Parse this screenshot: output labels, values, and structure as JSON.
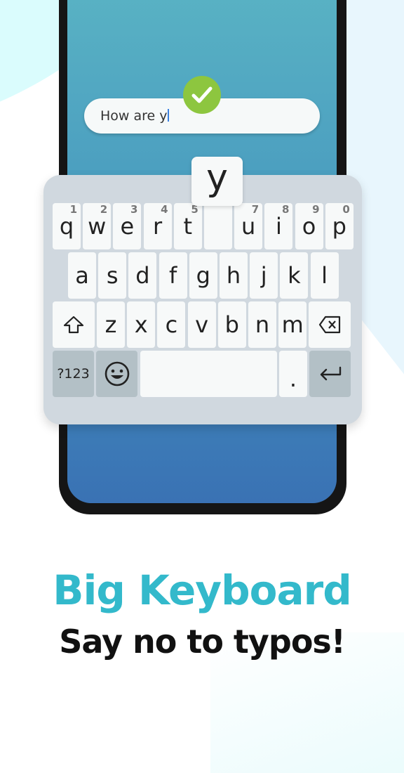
{
  "input": {
    "text": "How are y"
  },
  "status": {
    "icon": "checkmark-icon",
    "color": "#8dc63f"
  },
  "popup": {
    "letter": "y"
  },
  "keyboard": {
    "row1": [
      {
        "k": "q",
        "h": "1"
      },
      {
        "k": "w",
        "h": "2"
      },
      {
        "k": "e",
        "h": "3"
      },
      {
        "k": "r",
        "h": "4"
      },
      {
        "k": "t",
        "h": "5"
      },
      {
        "k": "",
        "h": ""
      },
      {
        "k": "u",
        "h": "7"
      },
      {
        "k": "i",
        "h": "8"
      },
      {
        "k": "o",
        "h": "9"
      },
      {
        "k": "p",
        "h": "0"
      }
    ],
    "row2": [
      "a",
      "s",
      "d",
      "f",
      "g",
      "h",
      "j",
      "k",
      "l"
    ],
    "row3": [
      "z",
      "x",
      "c",
      "v",
      "b",
      "n",
      "m"
    ],
    "symbols_label": "?123",
    "period_label": ".",
    "shift_icon": "shift-icon",
    "backspace_icon": "backspace-icon",
    "emoji_icon": "emoji-icon",
    "enter_icon": "enter-icon"
  },
  "headline": "Big Keyboard",
  "subline": "Say no to typos!",
  "colors": {
    "accent": "#33b9cb",
    "keyboard_bg": "#d0d8df",
    "key_bg": "#f7f9f9",
    "fn_key_bg": "#b3c0c6"
  }
}
